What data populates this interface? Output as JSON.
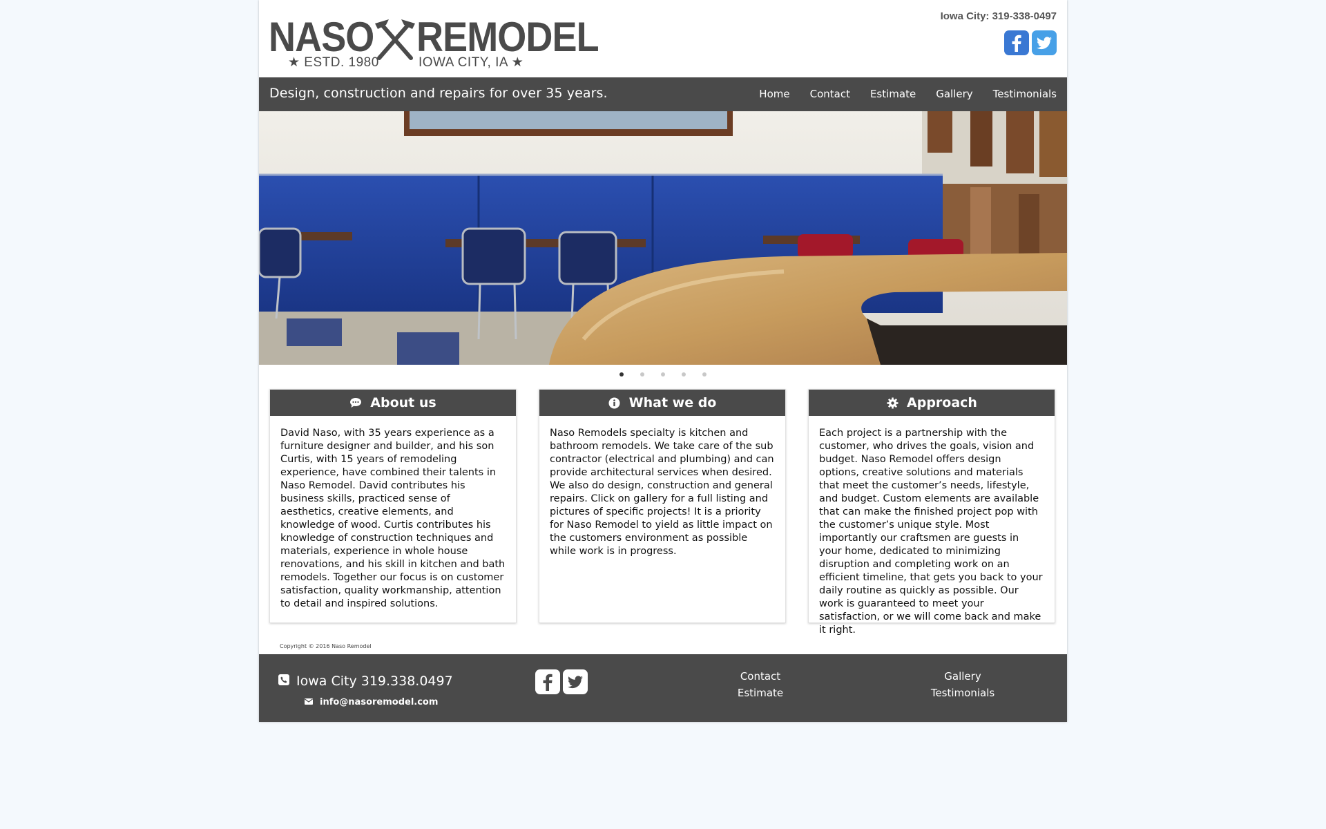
{
  "brand": {
    "name_left": "NASO",
    "name_right": "REMODEL",
    "established": "★ ESTD. 1980",
    "location": "IOWA CITY, IA ★"
  },
  "header": {
    "phone": "Iowa City: 319-338-0497",
    "social": [
      "facebook-icon",
      "twitter-icon"
    ]
  },
  "nav": {
    "tagline": "Design, construction and repairs for over 35 years.",
    "links": [
      "Home",
      "Contact",
      "Estimate",
      "Gallery",
      "Testimonials"
    ]
  },
  "slider": {
    "slide_count": 5,
    "active_index": 0
  },
  "cards": [
    {
      "title": "About us",
      "icon": "comment-icon",
      "body": "David Naso, with 35 years experience as a furniture designer and builder, and his son Curtis, with 15 years of remodeling experience, have combined their talents in Naso Remodel. David contributes his business skills, practiced sense of aesthetics, creative elements, and knowledge of wood. Curtis contributes his knowledge of construction techniques and materials, experience in whole house renovations, and his skill in kitchen and bath remodels. Together our focus is on customer satisfaction, quality workmanship, attention to detail and inspired solutions."
    },
    {
      "title": "What we do",
      "icon": "info-icon",
      "body": "Naso Remodels specialty is kitchen and bathroom remodels. We take care of the sub contractor (electrical and plumbing) and can provide architectural services when desired. We also do design, construction and general repairs. Click on gallery for a full listing and pictures of specific projects! It is a priority for Naso Remodel to yield as little impact on the customers environment as possible while work is in progress."
    },
    {
      "title": "Approach",
      "icon": "gear-icon",
      "body": "Each project is a partnership with the customer, who drives the goals, vision and budget. Naso Remodel offers design options, creative solutions and materials that meet the customer’s needs, lifestyle, and budget. Custom elements are available that can make the finished project pop with the customer’s unique style. Most importantly our craftsmen are guests in your home, dedicated to minimizing disruption and completing work on an efficient timeline, that gets you back to your daily routine as quickly as possible. Our work is guaranteed to meet your satisfaction, or we will come back and make it right."
    }
  ],
  "copyright": "Copyright © 2016 Naso Remodel",
  "footer": {
    "phone": "Iowa City 319.338.0497",
    "email": "info@nasoremodel.com",
    "col_a": [
      "Contact",
      "Estimate"
    ],
    "col_b": [
      "Gallery",
      "Testimonials"
    ]
  },
  "colors": {
    "page_bg": "#f4f9fd",
    "bar": "#4a4a4a",
    "facebook": "#3a78d3",
    "twitter": "#47a0e7"
  }
}
